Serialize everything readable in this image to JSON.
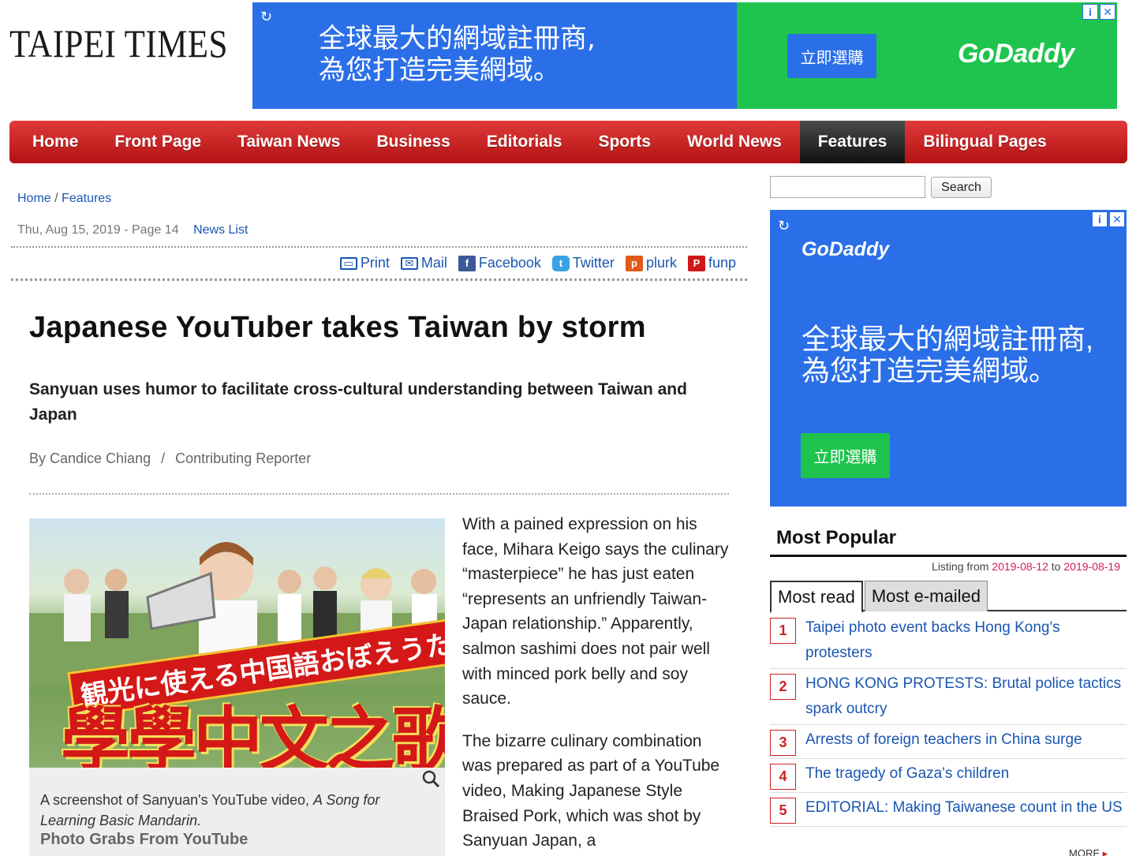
{
  "header": {
    "logo": "TAIPEI TIMES",
    "top_ad": {
      "text_line1": "全球最大的網域註冊商,",
      "text_line2": "為您打造完美網域。",
      "button": "立即選購",
      "brand": "GoDaddy",
      "info_icon": "i",
      "close_icon": "✕"
    }
  },
  "nav": {
    "items": [
      {
        "label": "Home"
      },
      {
        "label": "Front Page"
      },
      {
        "label": "Taiwan News"
      },
      {
        "label": "Business"
      },
      {
        "label": "Editorials"
      },
      {
        "label": "Sports"
      },
      {
        "label": "World News"
      },
      {
        "label": "Features"
      },
      {
        "label": "Bilingual Pages"
      }
    ],
    "active": "Features"
  },
  "breadcrumb": {
    "home": "Home",
    "separator": "/",
    "section": "Features"
  },
  "dateline": {
    "date": "Thu, Aug 15, 2019 - Page 14",
    "news_list": "News List"
  },
  "share": {
    "print": "Print",
    "mail": "Mail",
    "facebook": "Facebook",
    "twitter": "Twitter",
    "plurk": "plurk",
    "funp": "funp"
  },
  "article": {
    "headline": "Japanese YouTuber takes Taiwan by storm",
    "subhead": "Sanyuan uses humor to facilitate cross-cultural understanding between Taiwan and Japan",
    "author": "By Candice Chiang",
    "byline_sep": "/",
    "role": "Contributing Reporter",
    "photo": {
      "overlay_small": "観光に使える中国語おぼえうた",
      "overlay_large": "學學中文之歌",
      "caption_pre": "A screenshot of Sanyuan's YouTube video, ",
      "caption_italic": "A Song for Learning Basic Mandarin.",
      "credit": "Photo Grabs From YouTube"
    },
    "paragraphs": [
      "With a pained expression on his face, Mihara Keigo says the culinary “masterpiece” he has just eaten “represents an unfriendly Taiwan-Japan relationship.” Apparently, salmon sashimi does not pair well with minced pork belly and soy sauce.",
      "The bizarre culinary combination was prepared as part of a YouTube video, Making Japanese Style Braised Pork, which was shot by Sanyuan Japan, a"
    ]
  },
  "sidebar": {
    "search": {
      "placeholder": "",
      "button": "Search"
    },
    "ad": {
      "brand": "GoDaddy",
      "text_line1": "全球最大的網域註冊商,",
      "text_line2": "為您打造完美網域。",
      "button": "立即選購"
    },
    "most_popular": {
      "title": "Most Popular",
      "listing_prefix": "Listing from",
      "from": "2019-08-12",
      "to_word": "to",
      "to": "2019-08-19",
      "tabs": [
        "Most read",
        "Most e-mailed"
      ],
      "items": [
        {
          "num": "1",
          "title": "Taipei photo event backs Hong Kong's protesters"
        },
        {
          "num": "2",
          "title": "HONG KONG PROTESTS: Brutal police tactics spark outcry"
        },
        {
          "num": "3",
          "title": "Arrests of foreign teachers in China surge"
        },
        {
          "num": "4",
          "title": "The tragedy of Gaza's children"
        },
        {
          "num": "5",
          "title": "EDITORIAL: Making Taiwanese count in the US"
        }
      ],
      "more": "MORE"
    }
  }
}
